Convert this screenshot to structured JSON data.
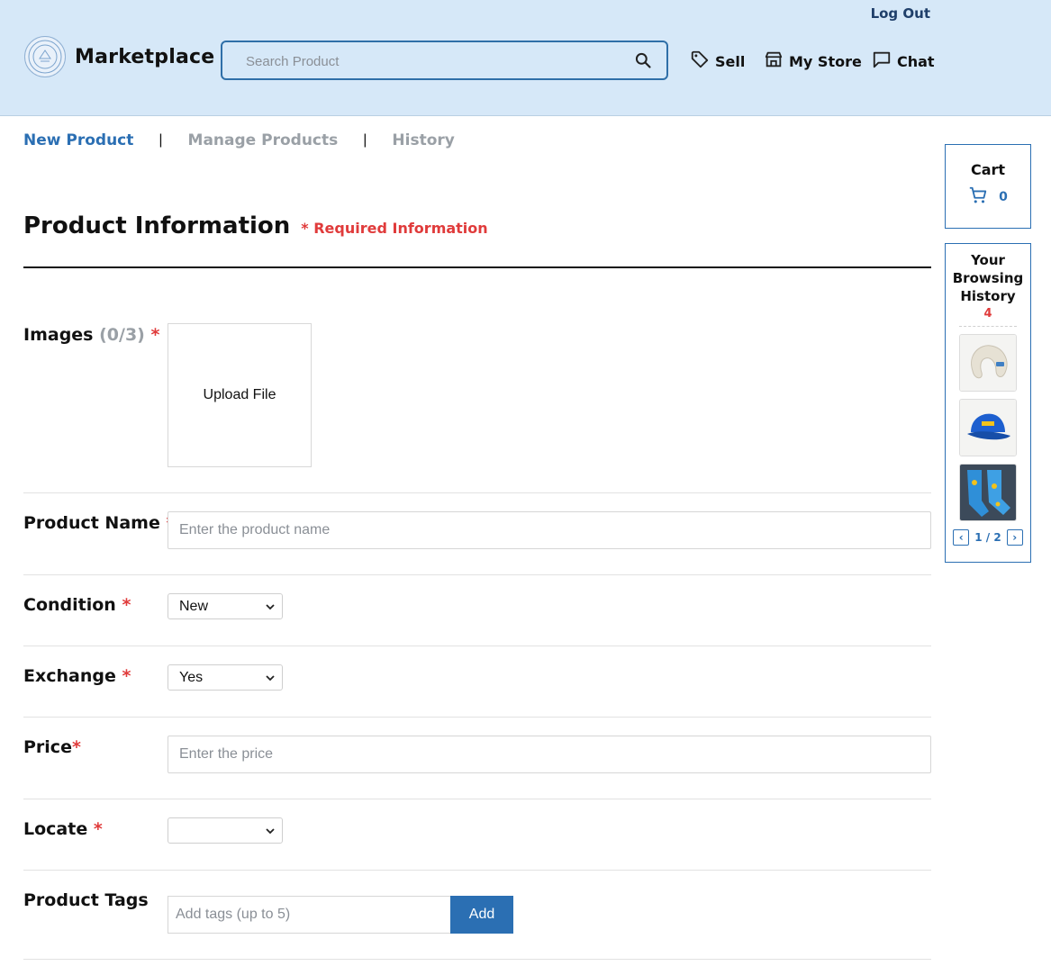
{
  "header": {
    "brand": "Marketplace",
    "logout": "Log Out",
    "search_placeholder": "Search Product",
    "nav": {
      "sell": "Sell",
      "my_store": "My Store",
      "chat": "Chat"
    }
  },
  "tabs": {
    "new_product": "New Product",
    "manage_products": "Manage Products",
    "history": "History",
    "separator": "|"
  },
  "page": {
    "title": "Product Information",
    "required_note": "* Required Information"
  },
  "form": {
    "star": "*",
    "images": {
      "label": "Images",
      "count": "(0/3)",
      "upload": "Upload File"
    },
    "product_name": {
      "label": "Product Name",
      "placeholder": "Enter the product name"
    },
    "condition": {
      "label": "Condition",
      "value": "New"
    },
    "exchange": {
      "label": "Exchange",
      "value": "Yes"
    },
    "price": {
      "label": "Price",
      "placeholder": "Enter the price"
    },
    "locate": {
      "label": "Locate",
      "value": ""
    },
    "tags": {
      "label": "Product Tags",
      "placeholder": "Add tags (up to 5)",
      "add": "Add"
    }
  },
  "sidebar": {
    "cart": {
      "title": "Cart",
      "count": "0"
    },
    "history": {
      "title_line1": "Your",
      "title_line2": "Browsing",
      "title_line3": "History",
      "count": "4",
      "page": "1 / 2",
      "prev": "‹",
      "next": "›"
    }
  },
  "colors": {
    "header_bg": "#d6e8f8",
    "accent": "#2b6fb3",
    "required": "#e03b3b",
    "muted": "#9aa0a6"
  },
  "icons": [
    "search-icon",
    "tag-icon",
    "store-icon",
    "chat-icon",
    "cart-icon"
  ]
}
